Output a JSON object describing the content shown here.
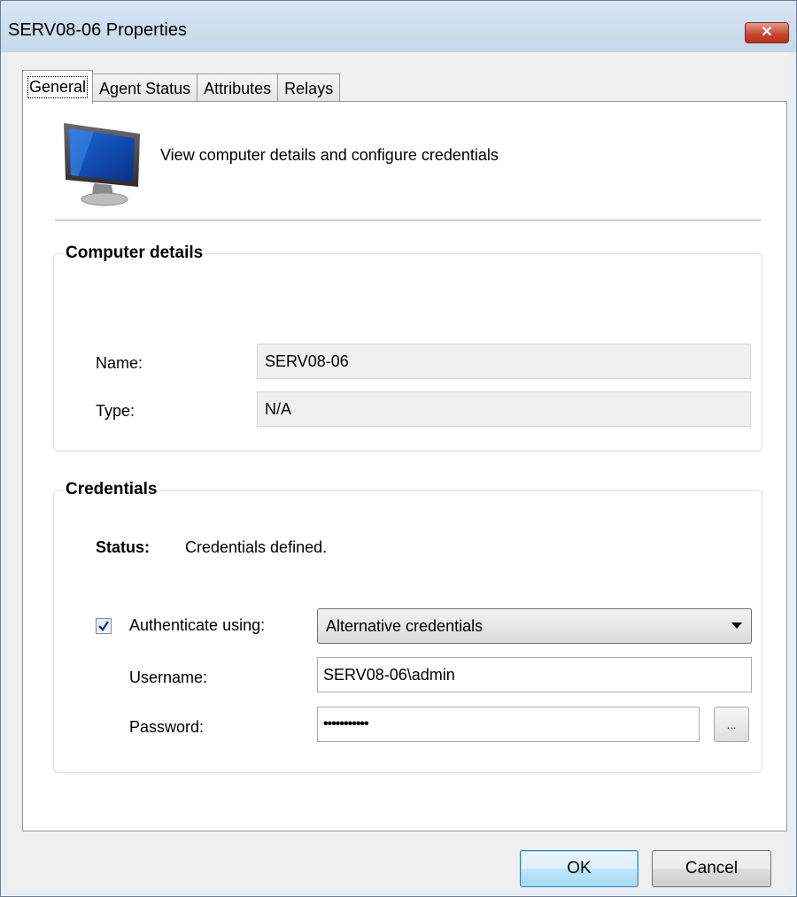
{
  "window": {
    "title": "SERV08-06 Properties",
    "close_symbol": "✕"
  },
  "tabs": [
    {
      "label": "General",
      "active": true
    },
    {
      "label": "Agent Status",
      "active": false
    },
    {
      "label": "Attributes",
      "active": false
    },
    {
      "label": "Relays",
      "active": false
    }
  ],
  "header": {
    "icon": "monitor-icon",
    "description": "View computer details and configure credentials"
  },
  "computer_details": {
    "title": "Computer details",
    "name_label": "Name:",
    "name_value": "SERV08-06",
    "type_label": "Type:",
    "type_value": "N/A"
  },
  "credentials": {
    "title": "Credentials",
    "status_label": "Status:",
    "status_value": "Credentials defined.",
    "authenticate_label": "Authenticate using:",
    "authenticate_checked": true,
    "authenticate_value": "Alternative credentials",
    "username_label": "Username:",
    "username_value": "SERV08-06\\admin",
    "password_label": "Password:",
    "password_value": "•••••••••••",
    "browse_label": "..."
  },
  "buttons": {
    "ok": "OK",
    "cancel": "Cancel"
  },
  "colors": {
    "title_bar": "#c5d8ec",
    "close_button": "#c94a35",
    "default_button_border": "#3c7fb1"
  }
}
